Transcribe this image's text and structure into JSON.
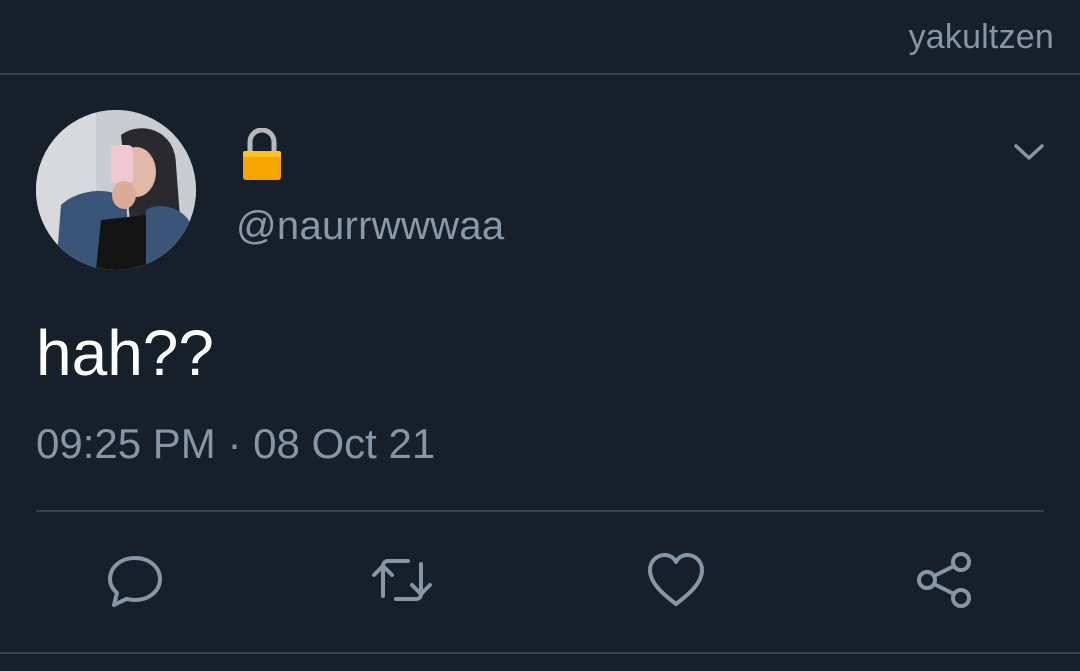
{
  "app": {
    "account_label": "yakultzen"
  },
  "tweet": {
    "handle": "@naurrwwwaa",
    "protected_icon": "lock-icon",
    "text": "hah??",
    "time": "09:25 PM",
    "separator": "·",
    "date": "08 Oct 21"
  },
  "actions": [
    {
      "name": "reply",
      "icon": "reply-icon"
    },
    {
      "name": "retweet",
      "icon": "retweet-icon"
    },
    {
      "name": "like",
      "icon": "heart-icon"
    },
    {
      "name": "share",
      "icon": "share-icon"
    }
  ],
  "colors": {
    "background": "#161f2a",
    "muted_text": "#8796a6",
    "divider": "#38444d",
    "primary_text": "#ffffff",
    "lock": "#f7a600"
  }
}
